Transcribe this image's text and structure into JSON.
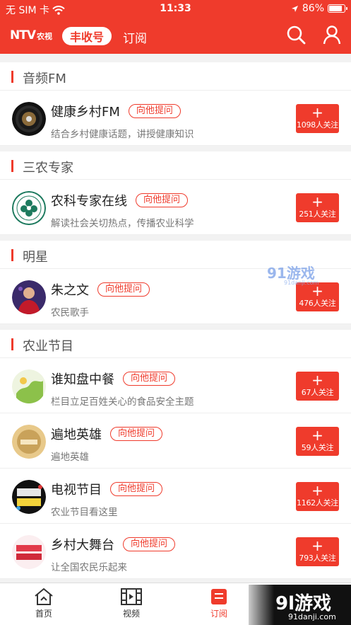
{
  "status_bar": {
    "carrier": "无 SIM 卡",
    "time": "11:33",
    "battery": "86%"
  },
  "nav": {
    "logo_main": "NTV",
    "logo_sub": "农视",
    "active_tab": "丰收号",
    "tab_subscribe": "订阅",
    "search_icon": "search-icon",
    "user_icon": "user-icon"
  },
  "colors": {
    "brand_red": "#ef3b2c"
  },
  "sections": [
    {
      "title": "音频FM",
      "items": [
        {
          "name": "健康乡村FM",
          "ask": "向他提问",
          "desc": "结合乡村健康话题，讲授健康知识",
          "plus": "+",
          "followers": "1098人关注"
        }
      ]
    },
    {
      "title": "三农专家",
      "items": [
        {
          "name": "农科专家在线",
          "ask": "向他提问",
          "desc": "解读社会关切热点，传播农业科学",
          "plus": "+",
          "followers": "251人关注"
        }
      ]
    },
    {
      "title": "明星",
      "items": [
        {
          "name": "朱之文",
          "ask": "向他提问",
          "desc": "农民歌手",
          "plus": "+",
          "followers": "476人关注"
        }
      ]
    },
    {
      "title": "农业节目",
      "items": [
        {
          "name": "谁知盘中餐",
          "ask": "向他提问",
          "desc": "栏目立足百姓关心的食品安全主题",
          "plus": "+",
          "followers": "67人关注"
        },
        {
          "name": "遍地英雄",
          "ask": "向他提问",
          "desc": "遍地英雄",
          "plus": "+",
          "followers": "59人关注"
        },
        {
          "name": "电视节目",
          "ask": "向他提问",
          "desc": "农业节目看这里",
          "plus": "+",
          "followers": "1162人关注"
        },
        {
          "name": "乡村大舞台",
          "ask": "向他提问",
          "desc": "让全国农民乐起来",
          "plus": "+",
          "followers": "793人关注"
        }
      ]
    }
  ],
  "bottom_tabs": [
    {
      "label": "首页",
      "icon": "home-icon"
    },
    {
      "label": "视频",
      "icon": "film-icon"
    },
    {
      "label": "订阅",
      "icon": "subscribe-icon"
    }
  ],
  "watermarks": {
    "top": "91游戏",
    "top_url": "91danji.com",
    "bottom": "9l游戏",
    "bottom_url": "91danji.com"
  }
}
